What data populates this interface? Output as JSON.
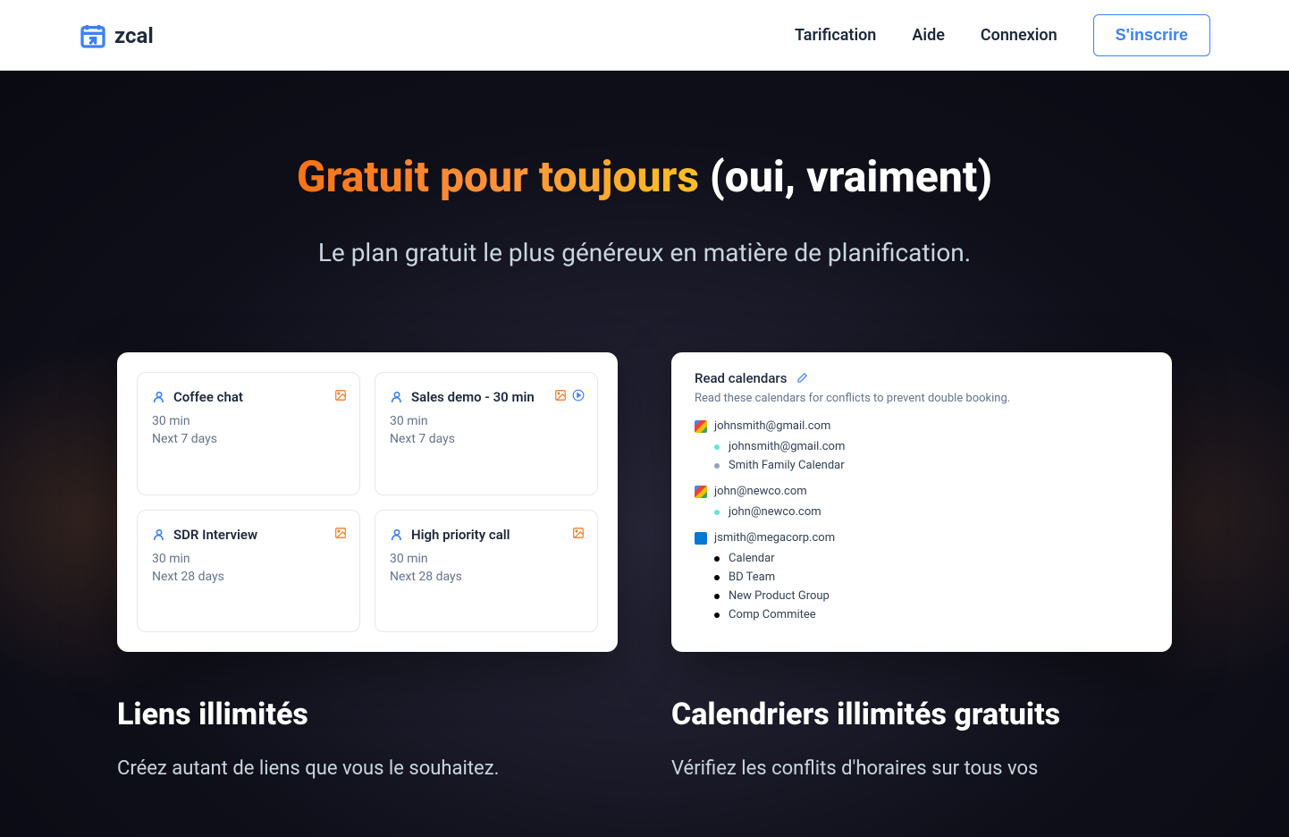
{
  "header": {
    "logo_text": "zcal",
    "nav": {
      "pricing": "Tarification",
      "help": "Aide",
      "login": "Connexion",
      "signup": "S'inscrire"
    }
  },
  "hero": {
    "title_gradient": "Gratuit pour toujours",
    "title_rest": " (oui, vraiment)",
    "subtitle": "Le plan gratuit le plus généreux en matière de planification."
  },
  "links_card": {
    "items": [
      {
        "title": "Coffee chat",
        "duration": "30 min",
        "range": "Next 7 days",
        "has_image": true,
        "has_play": false
      },
      {
        "title": "Sales demo - 30 min",
        "duration": "30 min",
        "range": "Next 7 days",
        "has_image": true,
        "has_play": true
      },
      {
        "title": "SDR Interview",
        "duration": "30 min",
        "range": "Next 28 days",
        "has_image": true,
        "has_play": false
      },
      {
        "title": "High priority call",
        "duration": "30 min",
        "range": "Next 28 days",
        "has_image": true,
        "has_play": false
      }
    ]
  },
  "calendars_card": {
    "title": "Read calendars",
    "subtitle": "Read these calendars for conflicts to prevent double booking.",
    "accounts": [
      {
        "provider": "google",
        "email": "johnsmith@gmail.com",
        "calendars": [
          {
            "name": "johnsmith@gmail.com",
            "color": "teal"
          },
          {
            "name": "Smith Family Calendar",
            "color": "gray"
          }
        ]
      },
      {
        "provider": "google",
        "email": "john@newco.com",
        "calendars": [
          {
            "name": "john@newco.com",
            "color": "teal"
          }
        ]
      },
      {
        "provider": "outlook",
        "email": "jsmith@megacorp.com",
        "calendars": [
          {
            "name": "Calendar",
            "color": "black"
          },
          {
            "name": "BD Team",
            "color": "black"
          },
          {
            "name": "New Product Group",
            "color": "black"
          },
          {
            "name": "Comp Commitee",
            "color": "black"
          }
        ]
      }
    ]
  },
  "features": {
    "left": {
      "title": "Liens illimités",
      "desc": "Créez autant de liens que vous le souhaitez."
    },
    "right": {
      "title": "Calendriers illimités gratuits",
      "desc": "Vérifiez les conflits d'horaires sur tous vos"
    }
  }
}
